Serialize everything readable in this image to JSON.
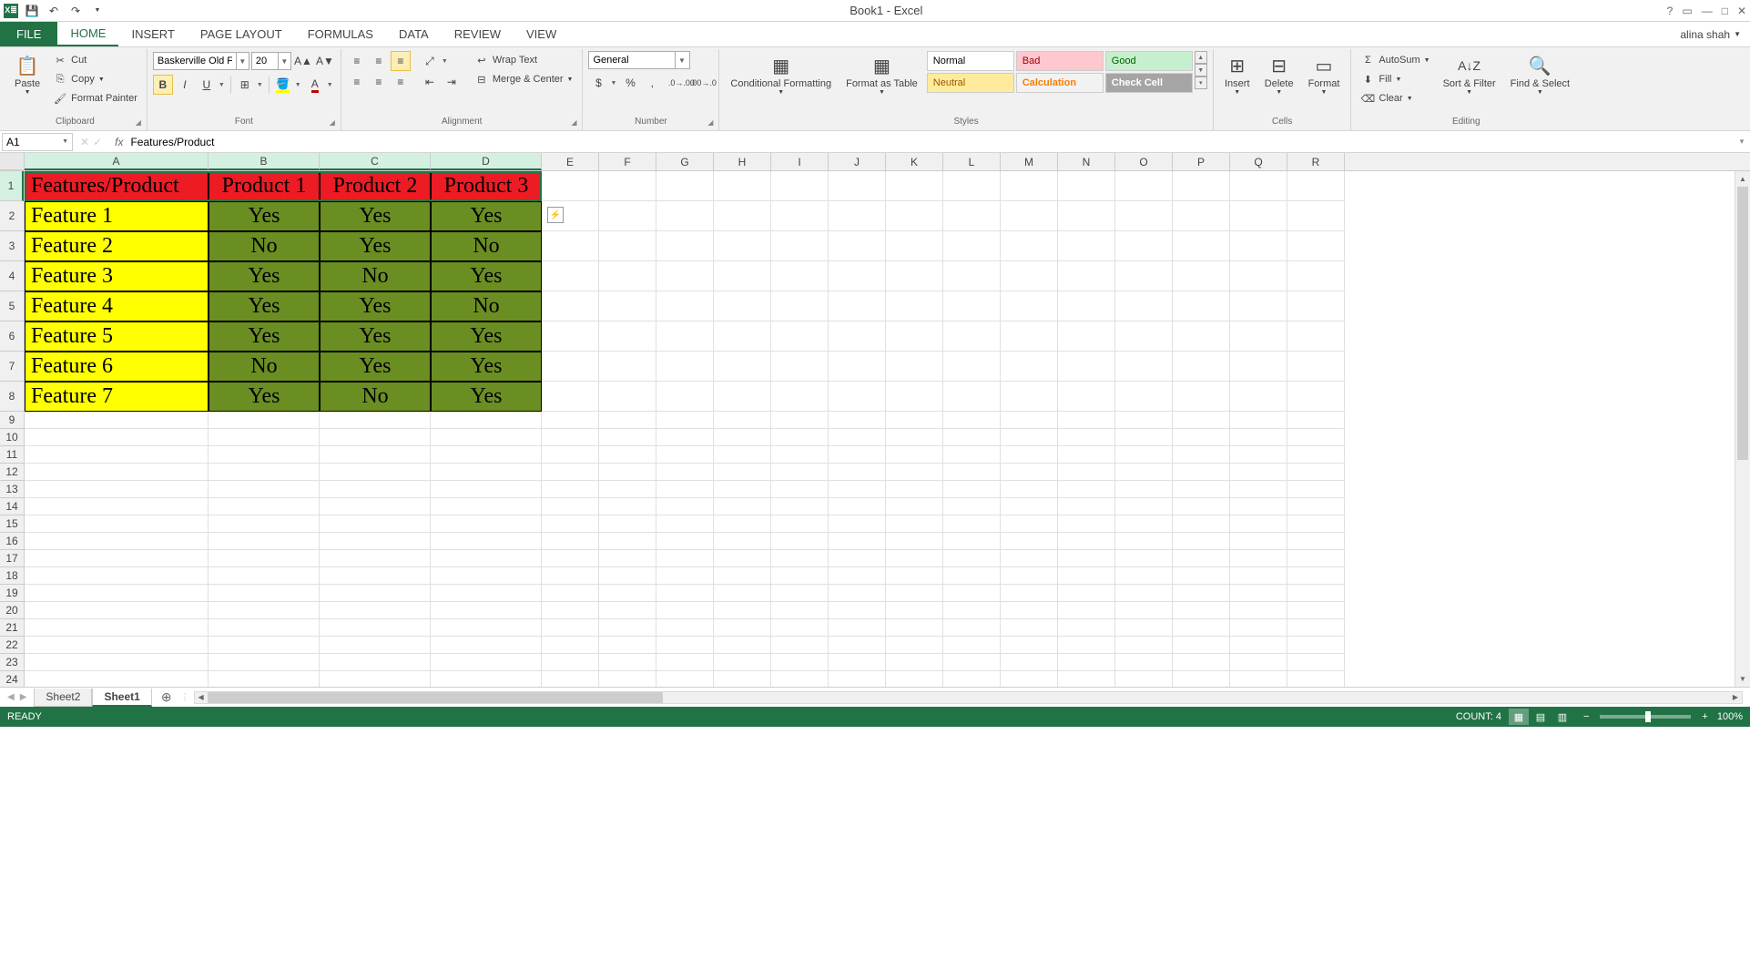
{
  "title": "Book1 - Excel",
  "user": "alina shah",
  "tabs": [
    "HOME",
    "INSERT",
    "PAGE LAYOUT",
    "FORMULAS",
    "DATA",
    "REVIEW",
    "VIEW"
  ],
  "file_tab": "FILE",
  "active_tab": "HOME",
  "clipboard": {
    "paste": "Paste",
    "cut": "Cut",
    "copy": "Copy",
    "format_painter": "Format Painter",
    "group": "Clipboard"
  },
  "font": {
    "name": "Baskerville Old Face",
    "size": "20",
    "group": "Font"
  },
  "alignment": {
    "wrap": "Wrap Text",
    "merge": "Merge & Center",
    "group": "Alignment"
  },
  "number": {
    "format": "General",
    "group": "Number"
  },
  "styles": {
    "cond": "Conditional Formatting",
    "fmttable": "Format as Table",
    "group": "Styles",
    "cells": [
      {
        "label": "Normal",
        "bg": "#ffffff",
        "fg": "#000000"
      },
      {
        "label": "Bad",
        "bg": "#ffc7ce",
        "fg": "#9c0006"
      },
      {
        "label": "Good",
        "bg": "#c6efce",
        "fg": "#006100"
      },
      {
        "label": "Neutral",
        "bg": "#ffeb9c",
        "fg": "#9c5700"
      },
      {
        "label": "Calculation",
        "bg": "#f2f2f2",
        "fg": "#fa7d00",
        "bold": true
      },
      {
        "label": "Check Cell",
        "bg": "#a5a5a5",
        "fg": "#ffffff",
        "bold": true
      }
    ]
  },
  "cells_group": {
    "insert": "Insert",
    "delete": "Delete",
    "format": "Format",
    "group": "Cells"
  },
  "editing": {
    "autosum": "AutoSum",
    "fill": "Fill",
    "clear": "Clear",
    "sort": "Sort & Filter",
    "find": "Find & Select",
    "group": "Editing"
  },
  "name_box": "A1",
  "formula": "Features/Product",
  "columns": [
    "A",
    "B",
    "C",
    "D",
    "E",
    "F",
    "G",
    "H",
    "I",
    "J",
    "K",
    "L",
    "M",
    "N",
    "O",
    "P",
    "Q",
    "R"
  ],
  "col_widths": {
    "A": 202,
    "B": 122,
    "C": 122,
    "D": 122,
    "default": 63
  },
  "row_heights": {
    "data": 33,
    "default": 19
  },
  "selected_cols": [
    "A",
    "B",
    "C",
    "D"
  ],
  "selected_row": 1,
  "sheet_data": {
    "headers": [
      "Features/Product",
      "Product 1",
      "Product 2",
      "Product 3"
    ],
    "rows": [
      {
        "feature": "Feature 1",
        "vals": [
          "Yes",
          "Yes",
          "Yes"
        ]
      },
      {
        "feature": "Feature 2",
        "vals": [
          "No",
          "Yes",
          "No"
        ]
      },
      {
        "feature": "Feature 3",
        "vals": [
          "Yes",
          "No",
          "Yes"
        ]
      },
      {
        "feature": "Feature 4",
        "vals": [
          "Yes",
          "Yes",
          "No"
        ]
      },
      {
        "feature": "Feature 5",
        "vals": [
          "Yes",
          "Yes",
          "Yes"
        ]
      },
      {
        "feature": "Feature 6",
        "vals": [
          "No",
          "Yes",
          "Yes"
        ]
      },
      {
        "feature": "Feature 7",
        "vals": [
          "Yes",
          "No",
          "Yes"
        ]
      }
    ]
  },
  "sheets": [
    "Sheet2",
    "Sheet1"
  ],
  "active_sheet": "Sheet1",
  "status": {
    "ready": "READY",
    "count_label": "COUNT:",
    "count_val": "4",
    "zoom": "100%"
  },
  "chart_data": {
    "type": "table",
    "title": "Features/Product",
    "columns": [
      "Features/Product",
      "Product 1",
      "Product 2",
      "Product 3"
    ],
    "rows": [
      [
        "Feature 1",
        "Yes",
        "Yes",
        "Yes"
      ],
      [
        "Feature 2",
        "No",
        "Yes",
        "No"
      ],
      [
        "Feature 3",
        "Yes",
        "No",
        "Yes"
      ],
      [
        "Feature 4",
        "Yes",
        "Yes",
        "No"
      ],
      [
        "Feature 5",
        "Yes",
        "Yes",
        "Yes"
      ],
      [
        "Feature 6",
        "No",
        "Yes",
        "Yes"
      ],
      [
        "Feature 7",
        "Yes",
        "No",
        "Yes"
      ]
    ]
  }
}
